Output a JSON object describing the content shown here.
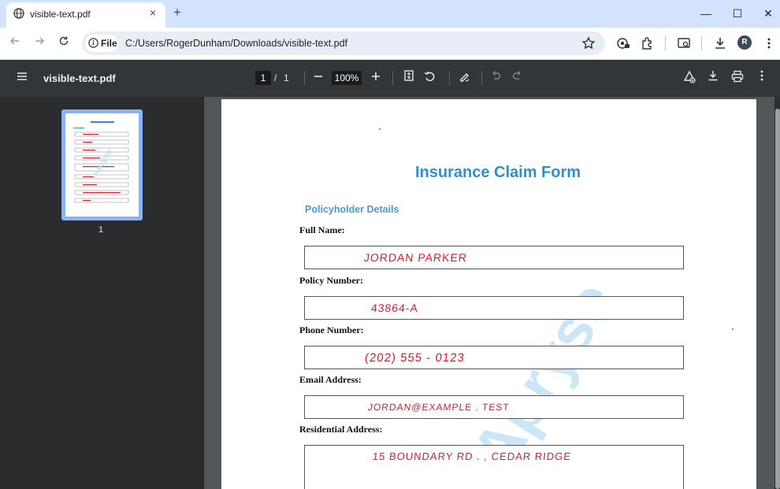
{
  "browser": {
    "tab_title": "visible-text.pdf",
    "tab_close": "×",
    "new_tab": "+",
    "url_chip": "File",
    "url": "C:/Users/RogerDunham/Downloads/visible-text.pdf",
    "profile_initial": "R",
    "window_minimize": "—",
    "window_maximize": "☐",
    "window_close": "✕"
  },
  "pdf_toolbar": {
    "title": "visible-text.pdf",
    "page_current": "1",
    "page_separator": "/",
    "page_total": "1",
    "zoom": "100%"
  },
  "sidebar": {
    "thumbnail_number": "1"
  },
  "document": {
    "title": "Insurance Claim Form",
    "section": "Policyholder Details",
    "watermark": "Apryse",
    "fields": [
      {
        "label": "Full Name:",
        "value": "JORDAN PARKER"
      },
      {
        "label": "Policy Number:",
        "value": "43864-A"
      },
      {
        "label": "Phone Number:",
        "value": "(202) 555 - 0123"
      },
      {
        "label": "Email Address:",
        "value": "JORDAN@EXAMPLE . TEST"
      },
      {
        "label": "Residential Address:",
        "value": "15 BOUNDARY RD . , CEDAR RIDGE"
      }
    ]
  },
  "colors": {
    "tabstrip": "#d3e3fd",
    "pdf_toolbar": "#323639",
    "title_blue": "#2f8fc8",
    "handwriting_red": "#d21f2c",
    "thumbnail_highlight": "#8ab4f8"
  }
}
